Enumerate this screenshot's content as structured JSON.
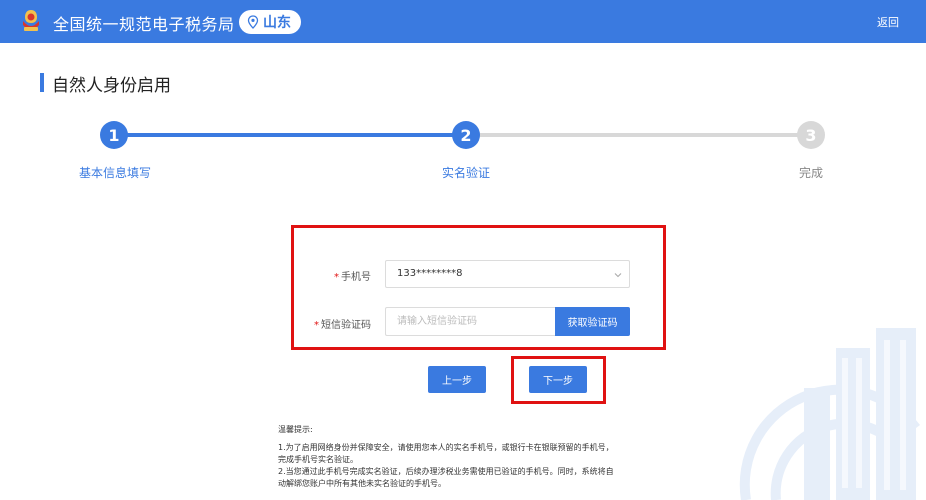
{
  "header": {
    "site_title": "全国统一规范电子税务局",
    "region": "山东",
    "back_label": "返回"
  },
  "page": {
    "title": "自然人身份启用"
  },
  "steps": [
    {
      "number": "1",
      "label": "基本信息填写",
      "state": "done"
    },
    {
      "number": "2",
      "label": "实名验证",
      "state": "active"
    },
    {
      "number": "3",
      "label": "完成",
      "state": "pending"
    }
  ],
  "form": {
    "phone_label": "手机号",
    "phone_value": "133********8",
    "sms_label": "短信验证码",
    "sms_placeholder": "请输入短信验证码",
    "get_code_label": "获取验证码",
    "required_mark": "*"
  },
  "actions": {
    "prev_label": "上一步",
    "next_label": "下一步"
  },
  "tips": {
    "title": "温馨提示:",
    "line1": "1.为了启用网络身份并保障安全，请使用您本人的实名手机号，或银行卡在银联预留的手机号，",
    "line2": "完成手机号实名验证。",
    "line3": "2.当您通过此手机号完成实名验证，后续办理涉税业务需使用已验证的手机号。同时，系统将自",
    "line4": "动解绑您账户中所有其他未实名验证的手机号。"
  },
  "colors": {
    "primary": "#3a7ae0",
    "highlight": "#e01212",
    "inactive": "#d8d8d8"
  },
  "icons": {
    "logo": "tax-emblem-icon",
    "region": "location-pin-icon",
    "select": "chevron-down-icon"
  }
}
